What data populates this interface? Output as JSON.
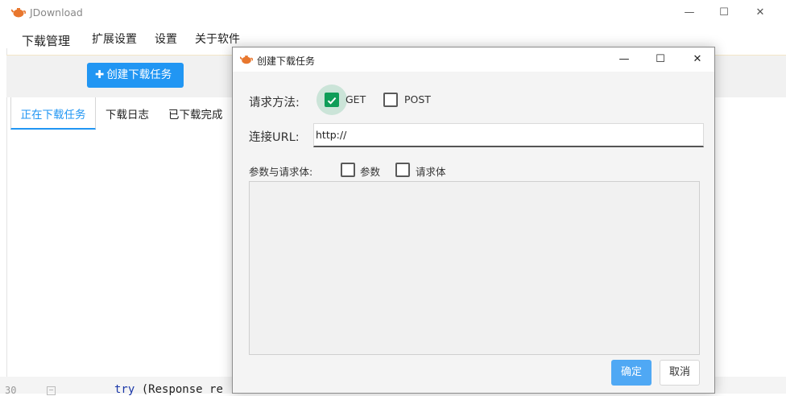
{
  "app": {
    "title": "JDownload",
    "menu": [
      "下载管理",
      "扩展设置",
      "设置",
      "关于软件"
    ],
    "toolbar": {
      "create_label": "创建下载任务",
      "create_icon": "plus-icon"
    },
    "tabs": [
      "正在下载任务",
      "下载日志",
      "已下载完成"
    ],
    "accent": "#2196f3"
  },
  "background_code": {
    "line_number": "30",
    "text_kw": "try",
    "text_rest": " (Response re"
  },
  "dialog": {
    "title": "创建下载任务",
    "method_label": "请求方法:",
    "methods": [
      {
        "label": "GET",
        "checked": true
      },
      {
        "label": "POST",
        "checked": false
      }
    ],
    "url_label": "连接URL:",
    "url_value": "http://",
    "params_label": "参数与请求体:",
    "params_options": [
      {
        "label": "参数",
        "checked": false
      },
      {
        "label": "请求体",
        "checked": false
      }
    ],
    "ok_label": "确定",
    "cancel_label": "取消",
    "check_color": "#0f9d58"
  }
}
